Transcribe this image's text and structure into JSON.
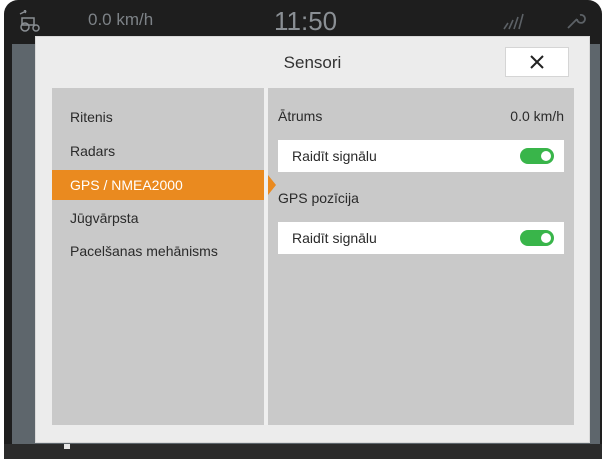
{
  "statusbar": {
    "speed": "0.0 km/h",
    "clock": "11:50",
    "icons": [
      "tractor-icon",
      "signal-icon",
      "wrench-icon"
    ]
  },
  "dialog": {
    "title": "Sensori",
    "close_icon": "close-icon"
  },
  "nav": {
    "items": [
      {
        "label": "Ritenis",
        "active": false
      },
      {
        "label": "Radars",
        "active": false
      },
      {
        "label": "GPS / NMEA2000",
        "active": true
      },
      {
        "label": "Jūgvārpsta",
        "active": false
      },
      {
        "label": "Pacelšanas mehānisms",
        "active": false
      }
    ]
  },
  "settings": {
    "speed": {
      "label": "Ātrums",
      "value": "0.0 km/h",
      "toggle_label": "Raidīt signālu",
      "toggle_on": true
    },
    "gps_position": {
      "label": "GPS pozīcija",
      "toggle_label": "Raidīt signālu",
      "toggle_on": true
    }
  },
  "colors": {
    "accent": "#ea8a1f",
    "toggle_on": "#39b54a",
    "panel": "#c9c9c9",
    "dialog": "#ececec"
  }
}
